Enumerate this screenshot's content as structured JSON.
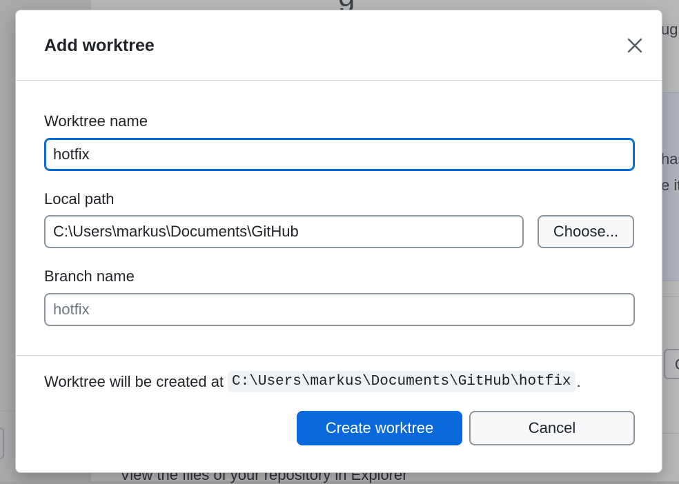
{
  "dialog": {
    "title": "Add worktree",
    "close_icon": "close-icon"
  },
  "fields": {
    "worktree_name": {
      "label": "Worktree name",
      "value": "hotfix"
    },
    "local_path": {
      "label": "Local path",
      "value": "C:\\Users\\markus\\Documents\\GitHub",
      "choose_label": "Choose..."
    },
    "branch_name": {
      "label": "Branch name",
      "value": "",
      "placeholder": "hotfix"
    }
  },
  "footer": {
    "note_prefix": "Worktree will be created at",
    "note_path": "C:\\Users\\markus\\Documents\\GitHub\\hotfix",
    "note_suffix": ".",
    "create_label": "Create worktree",
    "cancel_label": "Cancel"
  },
  "background": {
    "explorer_text": "View the files of your repository in Explorer",
    "top_fragment": "g",
    "right_fragment_1": "ug",
    "right_fragment_2": "has",
    "right_fragment_3": "e it",
    "right_button_fragment": "O"
  },
  "colors": {
    "accent": "#0969da",
    "dialog_bg": "#ffffff",
    "overlay": "#b6b7b9"
  }
}
